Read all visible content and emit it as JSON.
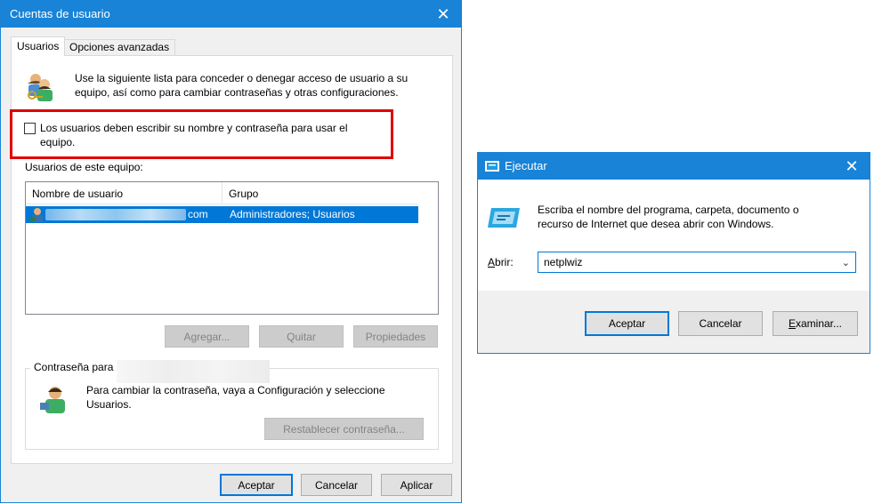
{
  "users_window": {
    "title": "Cuentas de usuario",
    "tabs": [
      {
        "label": "Usuarios"
      },
      {
        "label": "Opciones avanzadas"
      }
    ],
    "intro_line1": "Use la siguiente lista para conceder o denegar acceso de usuario a su",
    "intro_line2": "equipo, así como para cambiar contraseñas y otras configuraciones.",
    "checkbox_line1": "Los usuarios deben escribir su nombre y contraseña para usar el",
    "checkbox_line2": "equipo.",
    "checkbox_checked": false,
    "list_label": "Usuarios de este equipo:",
    "columns": [
      "Nombre de usuario",
      "Grupo"
    ],
    "rows": [
      {
        "username_suffix": "com",
        "group": "Administradores; Usuarios"
      }
    ],
    "buttons": {
      "add": "Agregar...",
      "remove": "Quitar",
      "properties": "Propiedades"
    },
    "password_group_label": "Contraseña para",
    "password_line1": "Para cambiar la contraseña, vaya a Configuración y seleccione",
    "password_line2": "Usuarios.",
    "reset_password": "Restablecer contraseña...",
    "footer": {
      "ok": "Aceptar",
      "cancel": "Cancelar",
      "apply": "Aplicar"
    },
    "accent_color": "#1883d7",
    "selection_color": "#0078d7",
    "highlight_color": "#e00000"
  },
  "run_window": {
    "title": "Ejecutar",
    "description_line1": "Escriba el nombre del programa, carpeta, documento o",
    "description_line2": "recurso de Internet que desea abrir con Windows.",
    "open_label_mnemonic": "A",
    "open_label_rest": "brir:",
    "command_value": "netplwiz",
    "buttons": {
      "ok": "Aceptar",
      "cancel": "Cancelar",
      "browse_mnemonic": "E",
      "browse_rest": "xaminar..."
    }
  }
}
